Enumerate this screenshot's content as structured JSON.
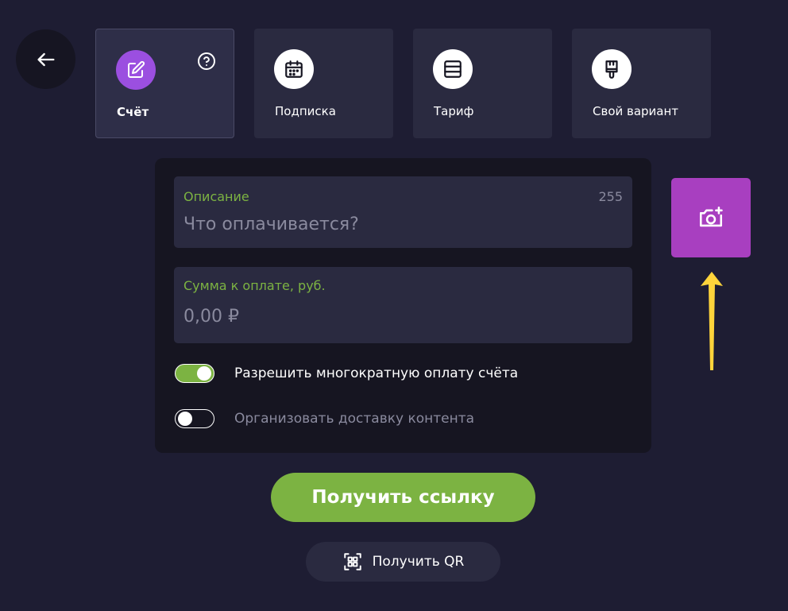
{
  "colors": {
    "background": "#1e1d33",
    "panel": "#161521",
    "card": "#2a2a40",
    "accent_green": "#7cb342",
    "accent_purple": "#9b4fe0",
    "photo_button": "#a83fc0",
    "annotation_arrow": "#ffd43b",
    "muted_text": "#8a8a9e"
  },
  "tabs": [
    {
      "label": "Счёт",
      "icon": "edit-icon",
      "active": true
    },
    {
      "label": "Подписка",
      "icon": "calendar-icon",
      "active": false
    },
    {
      "label": "Тариф",
      "icon": "list-icon",
      "active": false
    },
    {
      "label": "Свой вариант",
      "icon": "brush-icon",
      "active": false
    }
  ],
  "form": {
    "description": {
      "label": "Описание",
      "counter": "255",
      "placeholder": "Что оплачивается?",
      "value": ""
    },
    "amount": {
      "label": "Сумма к оплате, руб.",
      "placeholder": "0,00 ₽",
      "value": ""
    },
    "toggles": [
      {
        "label": "Разрешить многократную оплату счёта",
        "on": true
      },
      {
        "label": "Организовать доставку контента",
        "on": false
      }
    ]
  },
  "actions": {
    "get_link_label": "Получить ссылку",
    "get_qr_label": "Получить QR"
  }
}
